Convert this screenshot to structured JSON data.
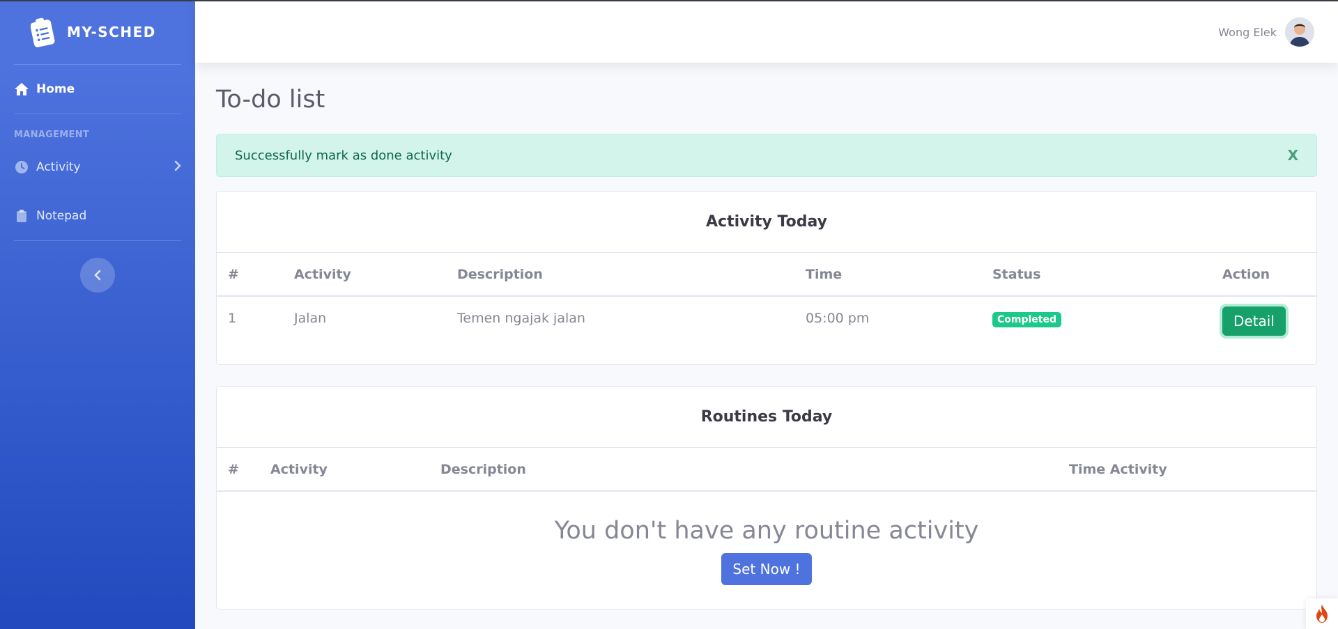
{
  "app": {
    "brand": "MY-SCHED"
  },
  "sidebar": {
    "home": "Home",
    "heading": "MANAGEMENT",
    "activity": "Activity",
    "notepad": "Notepad"
  },
  "topbar": {
    "username": "Wong Elek"
  },
  "page": {
    "title": "To-do list"
  },
  "alert": {
    "message": "Successfully mark as done activity",
    "close": "X"
  },
  "activity_card": {
    "title": "Activity Today",
    "columns": [
      "#",
      "Activity",
      "Description",
      "Time",
      "Status",
      "Action"
    ],
    "rows": [
      {
        "no": "1",
        "activity": "Jalan",
        "description": "Temen ngajak jalan",
        "time": "05:00 pm",
        "status": "Completed",
        "action": "Detail"
      }
    ]
  },
  "routines_card": {
    "title": "Routines Today",
    "columns": [
      "#",
      "Activity",
      "Description",
      "Time Activity"
    ],
    "empty_message": "You don't have any routine activity",
    "button": "Set Now !"
  },
  "colors": {
    "primary": "#4e73df",
    "success": "#1cc88a",
    "alert_bg": "#d2f4ea"
  }
}
